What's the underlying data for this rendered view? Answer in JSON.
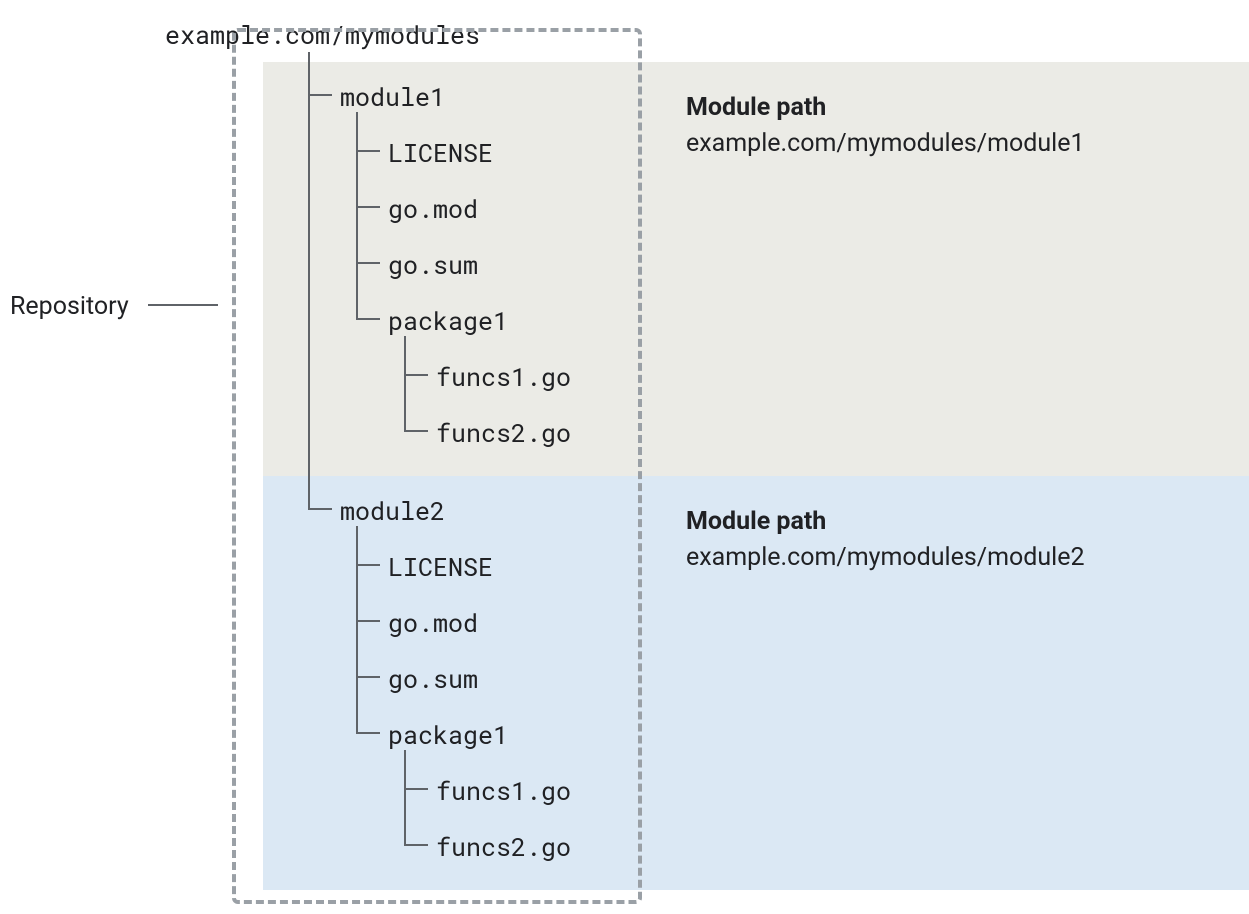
{
  "repository_label": "Repository",
  "root_path": "example.com/mymodules",
  "modules": [
    {
      "name": "module1",
      "heading": "Module path",
      "path": "example.com/mymodules/module1",
      "files": [
        "LICENSE",
        "go.mod",
        "go.sum"
      ],
      "package": {
        "name": "package1",
        "files": [
          "funcs1.go",
          "funcs2.go"
        ]
      }
    },
    {
      "name": "module2",
      "heading": "Module path",
      "path": "example.com/mymodules/module2",
      "files": [
        "LICENSE",
        "go.mod",
        "go.sum"
      ],
      "package": {
        "name": "package1",
        "files": [
          "funcs1.go",
          "funcs2.go"
        ]
      }
    }
  ]
}
